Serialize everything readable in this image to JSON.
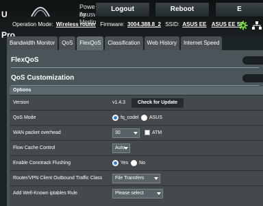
{
  "header": {
    "brand_fragment": "U Pro",
    "powered_line1": "Powered by",
    "powered_line2": "Asuswrt-Merlin",
    "logout_label": "Logout",
    "reboot_label": "Reboot",
    "lang_label": "E"
  },
  "status_line": {
    "op_mode_label": "Operation Mode:",
    "op_mode_value": "Wireless router",
    "firmware_label": "Firmware:",
    "firmware_value": "3004.388.8_2",
    "ssid_label": "SSID:",
    "ssid_1": "ASUS EE",
    "ssid_2": "ASUS EE 5G",
    "icons": [
      "gear-icon",
      "network-icon"
    ],
    "icon_colors": [
      "#6fdc3a",
      "#ffffff"
    ]
  },
  "tabs": [
    {
      "label": "Bandwidth Monitor",
      "active": false
    },
    {
      "label": "QoS",
      "active": false
    },
    {
      "label": "FlexQoS",
      "active": true
    },
    {
      "label": "Classification",
      "active": false
    },
    {
      "label": "Web History",
      "active": false
    },
    {
      "label": "Internet Speed",
      "active": false
    }
  ],
  "sections": {
    "flexqos_title": "FlexQoS",
    "customization_title": "QoS Customization"
  },
  "options": {
    "header": "Options",
    "version": {
      "label": "Version",
      "value": "v1.4.3",
      "button": "Check for Update"
    },
    "qos_mode": {
      "label": "QoS Mode",
      "option1": "fq_codel",
      "option2": "ASUS",
      "selected": "fq_codel"
    },
    "wan_overhead": {
      "label": "WAN packet overhead",
      "value": "30",
      "atm_label": "ATM"
    },
    "flow_cache": {
      "label": "Flow Cache Control",
      "value": "Auto"
    },
    "conntrack": {
      "label": "Enable Conntrack Flushing",
      "option1": "Yes",
      "option2": "No",
      "selected": "Yes"
    },
    "outbound_class": {
      "label": "Router/VPN Client Outbound Traffic Class",
      "value": "File Transfers"
    },
    "iptables_rule": {
      "label": "Add Well-Known iptables Rule",
      "value": "Please select"
    }
  },
  "colors": {
    "accent_green": "#6fdc3a",
    "radio_fill": "#2c7fd6"
  }
}
